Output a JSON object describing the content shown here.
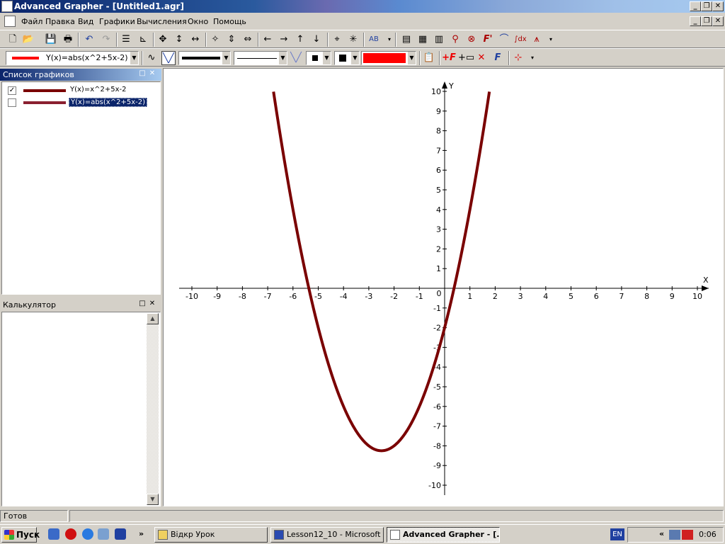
{
  "window": {
    "title": "Advanced Grapher - [Untitled1.agr]",
    "minimize": "_",
    "restore": "❐",
    "close": "✕"
  },
  "menu": {
    "items": [
      "Файл",
      "Правка",
      "Вид",
      "Графики",
      "Вычисления",
      "Окно",
      "Помощь"
    ]
  },
  "toolbar2": {
    "function_combo": "Y(x)=abs(x^2+5x-2)",
    "color_hex": "#ff0000"
  },
  "graph_list_panel": {
    "title": "Список графиков",
    "items": [
      {
        "label": "Y(x)=x^2+5x-2",
        "checked": true,
        "color": "#7a0000",
        "selected": false
      },
      {
        "label": "Y(x)=abs(x^2+5x-2)",
        "checked": false,
        "color": "#8a2030",
        "selected": true
      }
    ]
  },
  "calculator_panel": {
    "title": "Калькулятор"
  },
  "chart_data": {
    "type": "line",
    "function": "Y(x)=x^2+5x-2",
    "xlabel": "X",
    "ylabel": "Y",
    "xlim": [
      -10,
      10
    ],
    "ylim": [
      -10,
      10
    ],
    "x_ticks": [
      -10,
      -9,
      -8,
      -7,
      -6,
      -5,
      -4,
      -3,
      -2,
      -1,
      0,
      1,
      2,
      3,
      4,
      5,
      6,
      7,
      8,
      9,
      10
    ],
    "y_ticks": [
      -10,
      -9,
      -8,
      -7,
      -6,
      -5,
      -4,
      -3,
      -2,
      -1,
      1,
      2,
      3,
      4,
      5,
      6,
      7,
      8,
      9,
      10
    ],
    "origin_label": "0",
    "series": [
      {
        "color": "#7a0000",
        "x_range": [
          -6.77,
          1.77
        ],
        "x": [
          -6.77,
          -6.5,
          -6,
          -5.5,
          -5,
          -4.5,
          -4,
          -3.5,
          -3,
          -2.5,
          -2,
          -1.5,
          -1,
          -0.5,
          0,
          0.5,
          1,
          1.5,
          1.77
        ],
        "y": [
          10.0,
          7.75,
          4,
          0.75,
          -2,
          -4.25,
          -6,
          -7.25,
          -8,
          -8.25,
          -8,
          -7.25,
          -6,
          -4.25,
          -2,
          0.75,
          4,
          7.75,
          10.0
        ]
      }
    ],
    "grid": false
  },
  "status": {
    "text": "Готов"
  },
  "taskbar": {
    "start": "Пуск",
    "more": "»",
    "tasks": [
      {
        "label": "Відкр Урок",
        "active": false
      },
      {
        "label": "Lesson12_10 - Microsoft ...",
        "active": false
      },
      {
        "label": "Advanced Grapher - [...",
        "active": true
      }
    ],
    "lang": "EN",
    "tray_arrow": "«",
    "clock": "0:06"
  }
}
